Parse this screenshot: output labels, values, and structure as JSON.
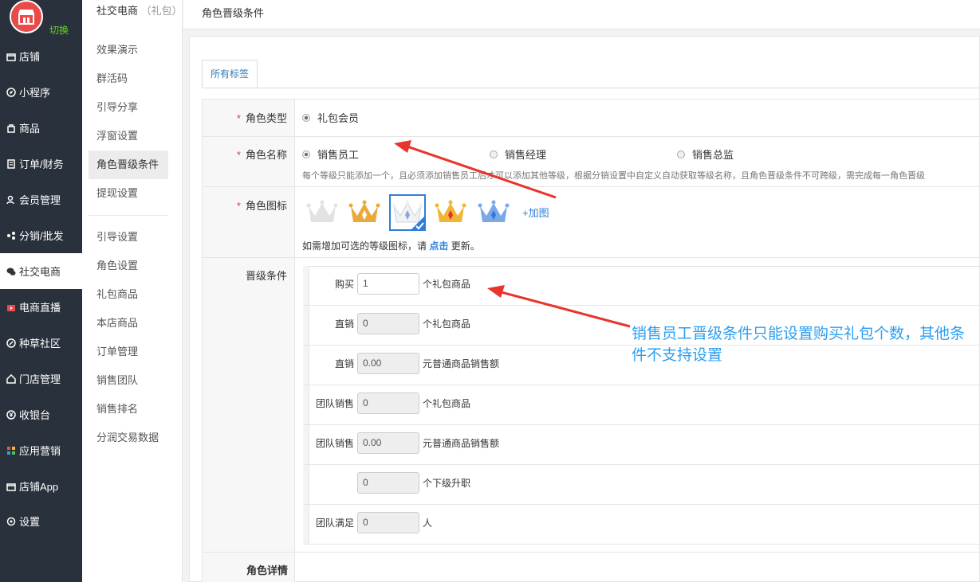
{
  "sidebar": {
    "switch_label": "切换",
    "items": [
      {
        "label": "店铺",
        "icon": "store-icon"
      },
      {
        "label": "小程序",
        "icon": "compass-icon"
      },
      {
        "label": "商品",
        "icon": "bag-icon"
      },
      {
        "label": "订单/财务",
        "icon": "order-icon"
      },
      {
        "label": "会员管理",
        "icon": "user-icon"
      },
      {
        "label": "分销/批发",
        "icon": "share-icon"
      },
      {
        "label": "社交电商",
        "icon": "wechat-icon"
      },
      {
        "label": "电商直播",
        "icon": "live-icon"
      },
      {
        "label": "种草社区",
        "icon": "leaf-icon"
      },
      {
        "label": "门店管理",
        "icon": "house-icon"
      },
      {
        "label": "收银台",
        "icon": "yen-icon"
      },
      {
        "label": "应用营销",
        "icon": "apps-icon"
      },
      {
        "label": "店铺App",
        "icon": "app-icon"
      },
      {
        "label": "设置",
        "icon": "gear-icon"
      }
    ],
    "active_index": 6
  },
  "subnav": {
    "title": "社交电商",
    "title_suffix": "（礼包）",
    "items": [
      "效果演示",
      "群活码",
      "引导分享",
      "浮窗设置",
      "角色晋级条件",
      "提现设置",
      "引导设置",
      "角色设置",
      "礼包商品",
      "本店商品",
      "订单管理",
      "销售团队",
      "销售排名",
      "分润交易数据"
    ],
    "active_index": 4
  },
  "topbar": {
    "title": "角色晋级条件"
  },
  "tab": {
    "label": "所有标签"
  },
  "form": {
    "role_type": {
      "label": "角色类型",
      "option": "礼包会员"
    },
    "role_name": {
      "label": "角色名称",
      "options": [
        "销售员工",
        "销售经理",
        "销售总监"
      ],
      "selected": "销售员工",
      "hint": "每个等级只能添加一个，且必须添加销售员工后才可以添加其他等级，根据分销设置中自定义自动获取等级名称，且角色晋级条件不可跨级，需完成每一角色晋级"
    },
    "role_icon": {
      "label": "角色图标",
      "add_label": "+加图",
      "note_prefix": "如需增加可选的等级图标，请",
      "note_link": "点击",
      "note_suffix": "更新。",
      "icons": [
        {
          "name": "silver",
          "color": "#e2e2e2",
          "gem": "#e2e2e2"
        },
        {
          "name": "gold",
          "color": "#e9a93b",
          "gem": "#ffffff"
        },
        {
          "name": "white",
          "color": "#f2f2f2",
          "gem": "#8aa6d8"
        },
        {
          "name": "gold-red",
          "color": "#f1b634",
          "gem": "#e0303a"
        },
        {
          "name": "blue",
          "color": "#7aa9ea",
          "gem": "#3b72d9"
        }
      ],
      "selected_index": 2
    },
    "upgrade": {
      "label": "晋级条件",
      "rows": [
        {
          "label": "购买",
          "value": "1",
          "unit": "个礼包商品",
          "editable": true
        },
        {
          "label": "直销",
          "value": "0",
          "unit": "个礼包商品",
          "editable": false
        },
        {
          "label": "直销",
          "value": "0.00",
          "unit": "元普通商品销售额",
          "editable": false
        },
        {
          "label": "团队销售",
          "value": "0",
          "unit": "个礼包商品",
          "editable": false
        },
        {
          "label": "团队销售",
          "value": "0.00",
          "unit": "元普通商品销售额",
          "editable": false
        },
        {
          "label": "",
          "value": "0",
          "unit": "个下级升职",
          "editable": false
        },
        {
          "label": "团队满足",
          "value": "0",
          "unit": "人",
          "editable": false
        }
      ]
    },
    "detail_label": "角色详情"
  },
  "annotation": {
    "text": "销售员工晋级条件只能设置购买礼包个数，其他条件不支持设置"
  },
  "colors": {
    "sidebar_bg": "#29323c",
    "accent": "#2f7fd8",
    "required": "#e4393c",
    "annotation": "#2c9ef0",
    "arrow": "#e8342a"
  }
}
